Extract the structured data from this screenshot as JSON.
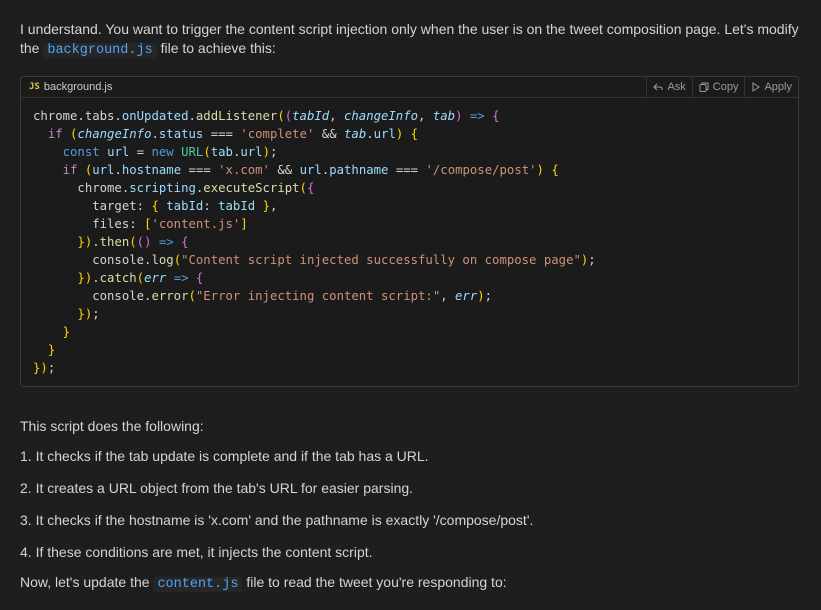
{
  "intro": {
    "pre": "I understand. You want to trigger the content script injection only when the user is on the tweet composition page. Let's modify the ",
    "code": "background.js",
    "post": " file to achieve this:"
  },
  "codeblock": {
    "lang_badge": "JS",
    "filename": "background.js",
    "actions": {
      "ask": "Ask",
      "copy": "Copy",
      "apply": "Apply"
    },
    "lines": [
      "chrome.tabs.onUpdated.addListener((tabId, changeInfo, tab) => {",
      "  if (changeInfo.status === 'complete' && tab.url) {",
      "    const url = new URL(tab.url);",
      "    if (url.hostname === 'x.com' && url.pathname === '/compose/post') {",
      "      chrome.scripting.executeScript({",
      "        target: { tabId: tabId },",
      "        files: ['content.js']",
      "      }).then(() => {",
      "        console.log(\"Content script injected successfully on compose page\");",
      "      }).catch(err => {",
      "        console.error(\"Error injecting content script:\", err);",
      "      });",
      "    }",
      "  }",
      "});"
    ]
  },
  "explanation": {
    "heading": "This script does the following:",
    "steps": [
      "1. It checks if the tab update is complete and if the tab has a URL.",
      "2. It creates a URL object from the tab's URL for easier parsing.",
      "3. It checks if the hostname is 'x.com' and the pathname is exactly '/compose/post'.",
      "4. If these conditions are met, it injects the content script."
    ]
  },
  "next": {
    "pre": "Now, let's update the ",
    "code": "content.js",
    "post": " file to read the tweet you're responding to:"
  }
}
